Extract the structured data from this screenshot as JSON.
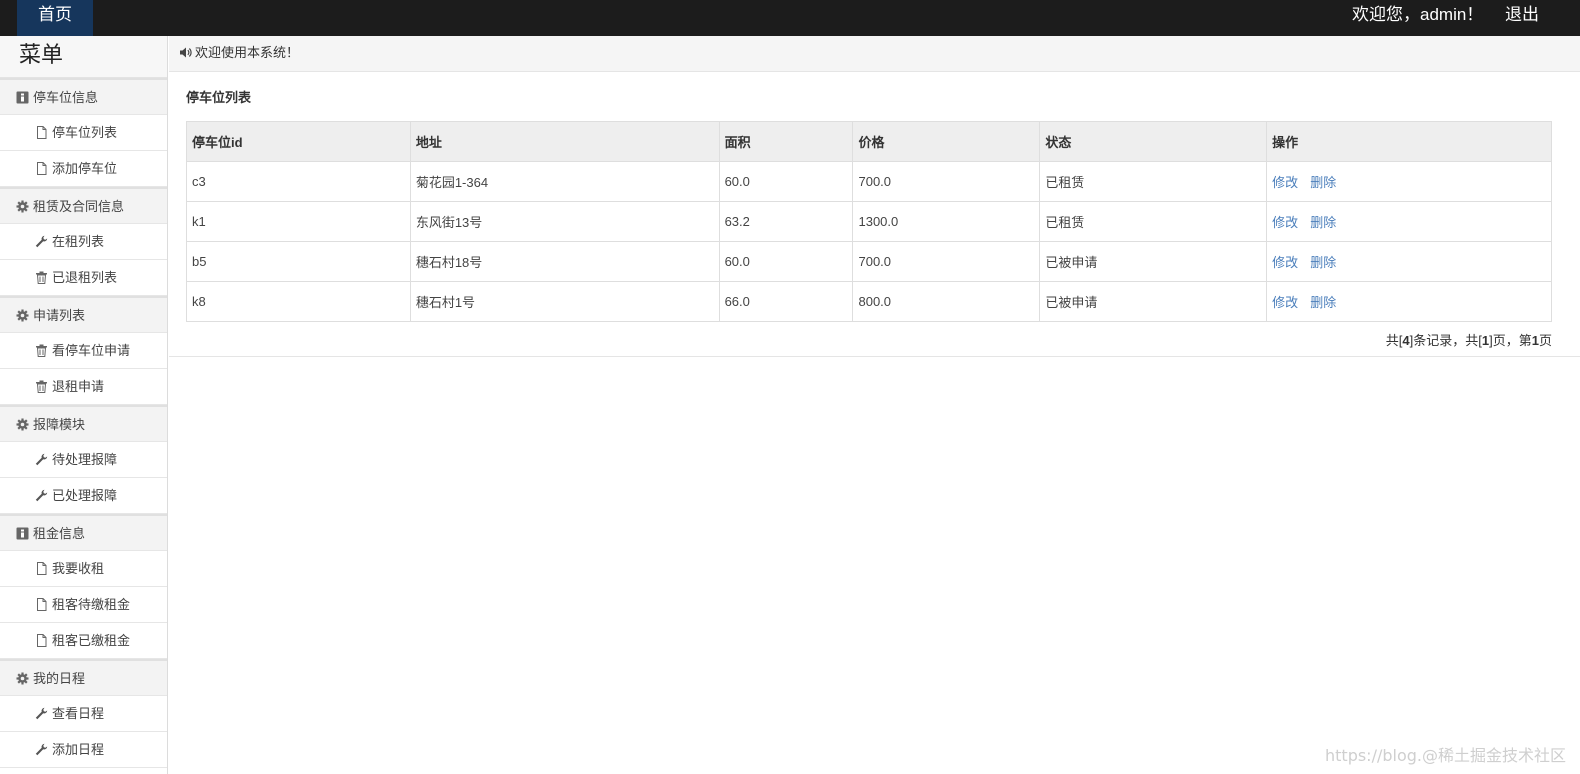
{
  "header": {
    "home_label": "首页",
    "welcome_text": "欢迎您，admin！",
    "logout_label": "退出"
  },
  "sidebar": {
    "title": "菜单",
    "groups": [
      {
        "label": "停车位信息",
        "icon": "info-icon",
        "items": [
          {
            "label": "停车位列表",
            "icon": "file-icon"
          },
          {
            "label": "添加停车位",
            "icon": "file-icon"
          }
        ]
      },
      {
        "label": "租赁及合同信息",
        "icon": "gear-icon",
        "items": [
          {
            "label": "在租列表",
            "icon": "wrench-icon"
          },
          {
            "label": "已退租列表",
            "icon": "trash-icon"
          }
        ]
      },
      {
        "label": "申请列表",
        "icon": "gear-icon",
        "items": [
          {
            "label": "看停车位申请",
            "icon": "trash-icon"
          },
          {
            "label": "退租申请",
            "icon": "trash-icon"
          }
        ]
      },
      {
        "label": "报障模块",
        "icon": "gear-icon",
        "items": [
          {
            "label": "待处理报障",
            "icon": "wrench-icon"
          },
          {
            "label": "已处理报障",
            "icon": "wrench-icon"
          }
        ]
      },
      {
        "label": "租金信息",
        "icon": "info-icon",
        "items": [
          {
            "label": "我要收租",
            "icon": "file-icon"
          },
          {
            "label": "租客待缴租金",
            "icon": "file-icon"
          },
          {
            "label": "租客已缴租金",
            "icon": "file-icon"
          }
        ]
      },
      {
        "label": "我的日程",
        "icon": "gear-icon",
        "items": [
          {
            "label": "查看日程",
            "icon": "wrench-icon"
          },
          {
            "label": "添加日程",
            "icon": "wrench-icon"
          }
        ]
      }
    ]
  },
  "notice": {
    "text": "欢迎使用本系统！",
    "icon": "volume-icon"
  },
  "panel": {
    "title": "停车位列表",
    "columns": [
      "停车位id",
      "地址",
      "面积",
      "价格",
      "状态",
      "操作"
    ],
    "rows": [
      {
        "id": "c3",
        "address": "菊花园1-364",
        "area": "60.0",
        "price": "700.0",
        "status": "已租赁",
        "edit": "修改",
        "delete": "删除"
      },
      {
        "id": "k1",
        "address": "东风街13号",
        "area": "63.2",
        "price": "1300.0",
        "status": "已租赁",
        "edit": "修改",
        "delete": "删除"
      },
      {
        "id": "b5",
        "address": "穗石村18号",
        "area": "60.0",
        "price": "700.0",
        "status": "已被申请",
        "edit": "修改",
        "delete": "删除"
      },
      {
        "id": "k8",
        "address": "穗石村1号",
        "area": "66.0",
        "price": "800.0",
        "status": "已被申请",
        "edit": "修改",
        "delete": "删除"
      }
    ]
  },
  "pager": {
    "p1": "共[",
    "total_records": "4",
    "p2": "]条记录，共[",
    "total_pages": "1",
    "p3": "]页，第",
    "current_page": "1",
    "p4": "页"
  },
  "watermark": "https://blog.@稀土掘金技术社区",
  "colors": {
    "topbar": "#1c1c1c",
    "home_tab": "#16365c",
    "link": "#4a7ebb"
  }
}
